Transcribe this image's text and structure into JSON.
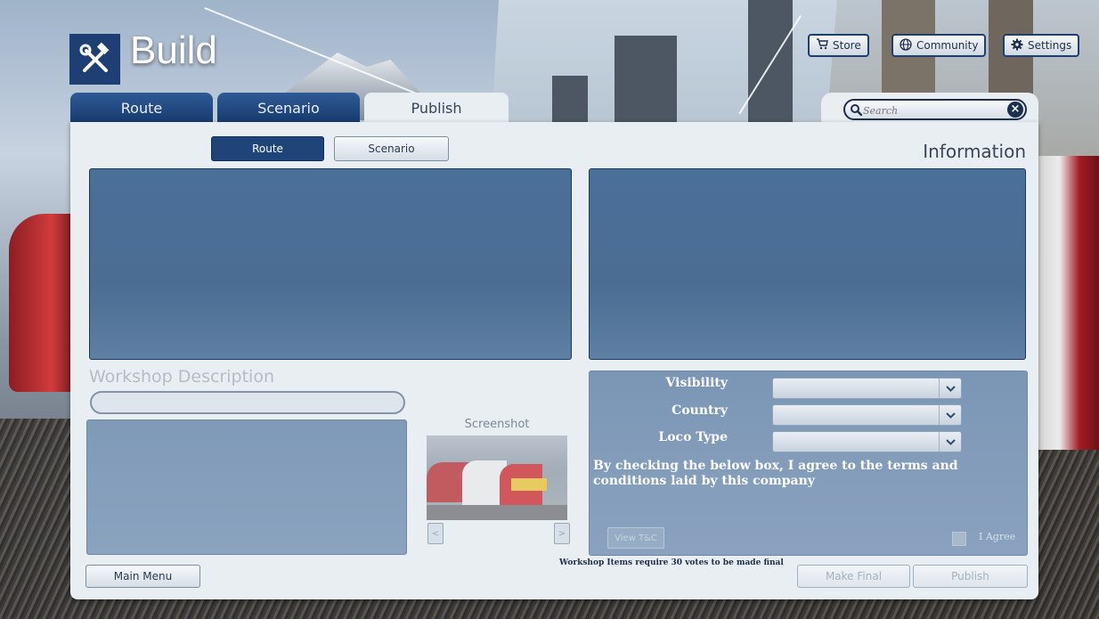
{
  "app": {
    "title": "Build",
    "icon": "hammer-wrench-icon"
  },
  "top_buttons": [
    {
      "label": "Store",
      "icon": "cart-icon"
    },
    {
      "label": "Community",
      "icon": "globe-icon"
    },
    {
      "label": "Settings",
      "icon": "gear-icon"
    }
  ],
  "tabs": [
    {
      "label": "Route",
      "active": false
    },
    {
      "label": "Scenario",
      "active": false
    },
    {
      "label": "Publish",
      "active": true
    }
  ],
  "search": {
    "placeholder": "Search",
    "clear_icon": "close-icon",
    "icon": "search-icon"
  },
  "publish_panel": {
    "mode_buttons": [
      {
        "label": "Route",
        "active": true
      },
      {
        "label": "Scenario",
        "active": false
      }
    ],
    "information_title": "Information",
    "workshop_description_label": "Workshop Description",
    "screenshot_label": "Screenshot",
    "screenshot_prev": "<",
    "screenshot_next": ">",
    "options": [
      {
        "label": "Visibility",
        "value": ""
      },
      {
        "label": "Country",
        "value": ""
      },
      {
        "label": "Loco Type",
        "value": ""
      }
    ],
    "terms_text": "By checking the below box, I agree to the terms and conditions laid by this company",
    "view_tc_label": "View T&C",
    "agree_label": "I Agree",
    "agree_checked": false
  },
  "footer": {
    "main_menu_label": "Main Menu",
    "vote_note": "Workshop Items require 30 votes to be made final",
    "make_final_label": "Make Final",
    "publish_label": "Publish"
  },
  "colors": {
    "accent_dark_blue": "#1f4478",
    "panel_bg": "#e9eef3",
    "content_blue": "#4b6d93"
  }
}
